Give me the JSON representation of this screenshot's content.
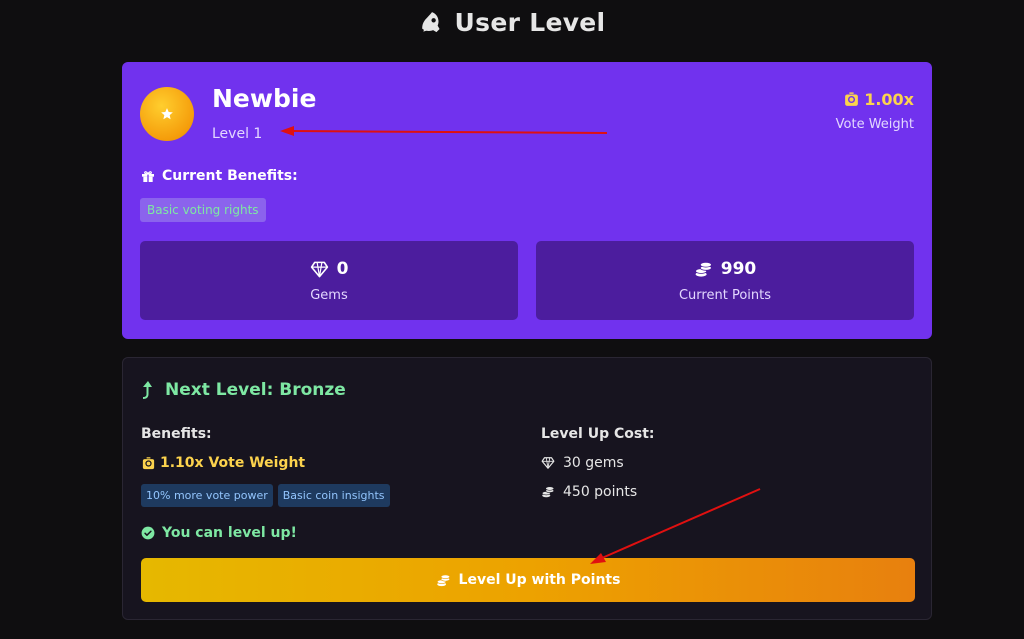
{
  "page": {
    "title": "User Level",
    "title_icon": "rocket-icon"
  },
  "current_level": {
    "name": "Newbie",
    "level_label": "Level 1",
    "badge_icon": "star-icon",
    "vote_weight_value": "1.00x",
    "vote_weight_label": "Vote Weight",
    "benefits_title": "Current Benefits:",
    "benefits": [
      "Basic voting rights"
    ],
    "stats": {
      "gems": {
        "value": "0",
        "label": "Gems",
        "icon": "gem-icon"
      },
      "points": {
        "value": "990",
        "label": "Current Points",
        "icon": "coins-icon"
      }
    }
  },
  "next_level": {
    "title": "Next Level: Bronze",
    "benefits_heading": "Benefits:",
    "vote_weight": "1.10x Vote Weight",
    "benefit_tags": [
      "10% more vote power",
      "Basic coin insights"
    ],
    "cost_heading": "Level Up Cost:",
    "cost_gems": "30 gems",
    "cost_points": "450 points",
    "status": "You can level up!",
    "button_label": "Level Up with Points"
  },
  "colors": {
    "card_purple": "#7132ee",
    "stat_box": "#4c1d9e",
    "gold": "#fcd34d",
    "green": "#7ee8a3",
    "annotation_arrow": "#e01010"
  }
}
